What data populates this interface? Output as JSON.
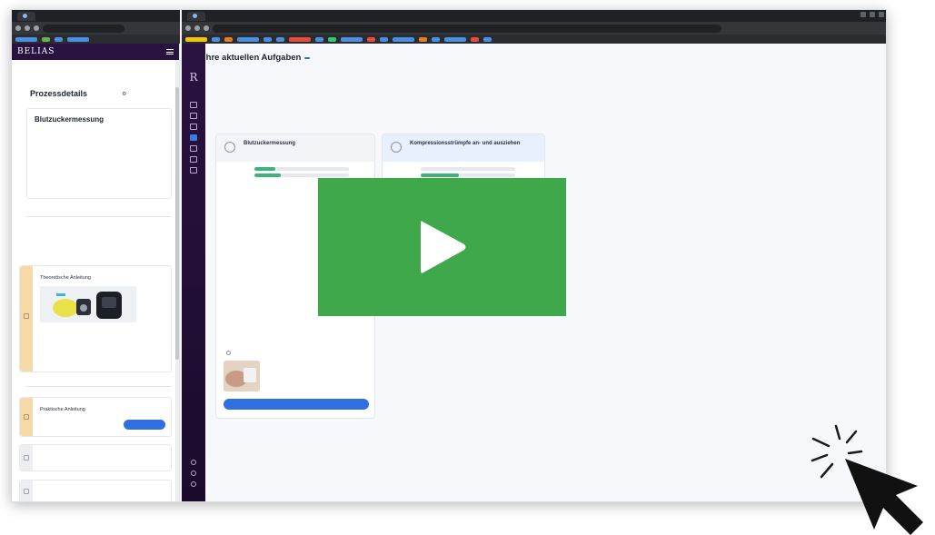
{
  "left_window": {
    "browser": {
      "tab_title": "",
      "url": "",
      "bookmark_colors": [
        "#4a90e2",
        "#6ab04c",
        "#4a90e2",
        "#4a90e2"
      ]
    },
    "logo": "BELIAS",
    "back_link": "",
    "title": "Prozessdetails",
    "admin_label": "",
    "details": {
      "title": "Blutzuckermessung",
      "rows": [
        {
          "label": "",
          "value": ""
        },
        {
          "label": "",
          "value": ""
        },
        {
          "label": "",
          "value": ""
        }
      ]
    },
    "divider1": "",
    "step1": {
      "title": "Theoretische Anleitung",
      "caption": "",
      "time": "",
      "note": ""
    },
    "divider2": "",
    "step2": {
      "title": "Praktische Anleitung",
      "button": ""
    },
    "step3": {
      "title": "",
      "status": ""
    },
    "step4": {
      "title": "",
      "status": ""
    }
  },
  "right_window": {
    "browser": {
      "tab_title": "",
      "url": "",
      "bookmark_colors": [
        "#f1c40f",
        "#4a90e2",
        "#e67e22",
        "#4a90e2",
        "#4a90e2",
        "#4a90e2",
        "#e74c3c",
        "#4a90e2",
        "#2ecc71",
        "#4a90e2",
        "#e74c3c",
        "#4a90e2",
        "#4a90e2",
        "#e67e22",
        "#4a90e2",
        "#4a90e2",
        "#e74c3c",
        "#4a90e2"
      ]
    },
    "rail_logo": "R",
    "heading": "Ihre aktuellen Aufgaben",
    "heading_count": "",
    "sub1": "",
    "sub2": "",
    "tasks": [
      {
        "name": "Blutzuckermessung",
        "subtitle": "",
        "progress_label": "",
        "progress": [
          {
            "label": "",
            "fraction": 0.22
          },
          {
            "label": "",
            "fraction": 0.28
          }
        ],
        "next_step": "",
        "lesson_title": "",
        "lesson_duration": "",
        "cta": ""
      },
      {
        "name": "Kompressionsstrümpfe an- und ausziehen",
        "subtitle": "",
        "progress_label": "",
        "progress": [
          {
            "label": "",
            "fraction": 0.0
          },
          {
            "label": "",
            "fraction": 0.4
          }
        ],
        "next_step": "",
        "lesson_title": "",
        "lesson_duration": "",
        "cta": ""
      }
    ],
    "footer_line1": "",
    "footer_line2": ""
  },
  "overlay": {
    "icon": "play-icon",
    "color": "#3fa84a"
  }
}
